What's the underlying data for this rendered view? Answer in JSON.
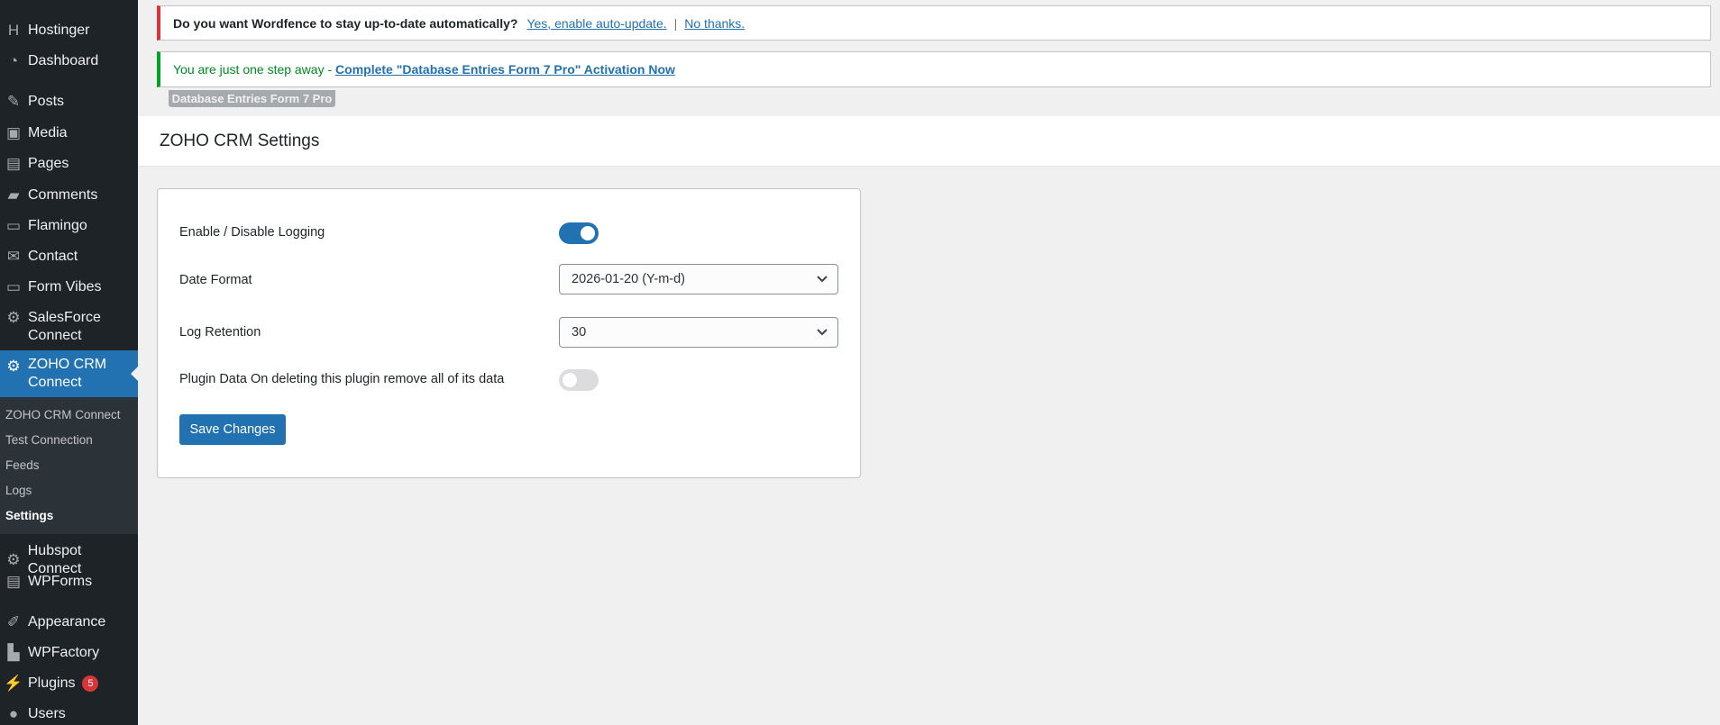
{
  "sidebar": {
    "items": [
      {
        "label": "Hostinger",
        "icon": "hostinger-icon"
      },
      {
        "label": "Dashboard",
        "icon": "dashboard-icon"
      },
      {
        "label": "Posts",
        "icon": "pin-icon"
      },
      {
        "label": "Media",
        "icon": "media-icon"
      },
      {
        "label": "Pages",
        "icon": "pages-icon"
      },
      {
        "label": "Comments",
        "icon": "comment-icon"
      },
      {
        "label": "Flamingo",
        "icon": "flamingo-icon"
      },
      {
        "label": "Contact",
        "icon": "mail-icon"
      },
      {
        "label": "Form Vibes",
        "icon": "form-icon"
      },
      {
        "label": "SalesForce Connect",
        "icon": "gear-icon"
      },
      {
        "label": "ZOHO CRM Connect",
        "icon": "gear-icon"
      },
      {
        "label": "Hubspot Connect",
        "icon": "gear-icon"
      },
      {
        "label": "WPForms",
        "icon": "wpforms-icon"
      },
      {
        "label": "Appearance",
        "icon": "brush-icon"
      },
      {
        "label": "WPFactory",
        "icon": "factory-icon"
      },
      {
        "label": "Plugins",
        "icon": "plugin-icon",
        "badge": "5"
      },
      {
        "label": "Users",
        "icon": "user-icon"
      }
    ],
    "submenu": [
      "ZOHO CRM Connect",
      "Test Connection",
      "Feeds",
      "Logs",
      "Settings"
    ]
  },
  "notices": {
    "wordfence": {
      "text": "Do you want Wordfence to stay up-to-date automatically?",
      "yes": "Yes, enable auto-update.",
      "sep": "|",
      "no": "No thanks."
    },
    "dbentries": {
      "text": "You are just one step away - ",
      "link": "Complete \"Database Entries Form 7 Pro\" Activation Now",
      "tag": "Database Entries Form 7 Pro"
    }
  },
  "page": {
    "title": "ZOHO CRM Settings"
  },
  "settings": {
    "logging": {
      "label": "Enable / Disable Logging",
      "enabled": true
    },
    "date_format": {
      "label": "Date Format",
      "value": "2026-01-20 (Y-m-d)"
    },
    "log_retention": {
      "label": "Log Retention",
      "value": "30"
    },
    "plugin_data": {
      "label": "Plugin Data On deleting this plugin remove all of its data",
      "enabled": false
    },
    "save": "Save Changes"
  },
  "colors": {
    "accent": "#2271b1",
    "sidebar": "#1d2327",
    "error": "#d63638",
    "success": "#00a32a"
  }
}
